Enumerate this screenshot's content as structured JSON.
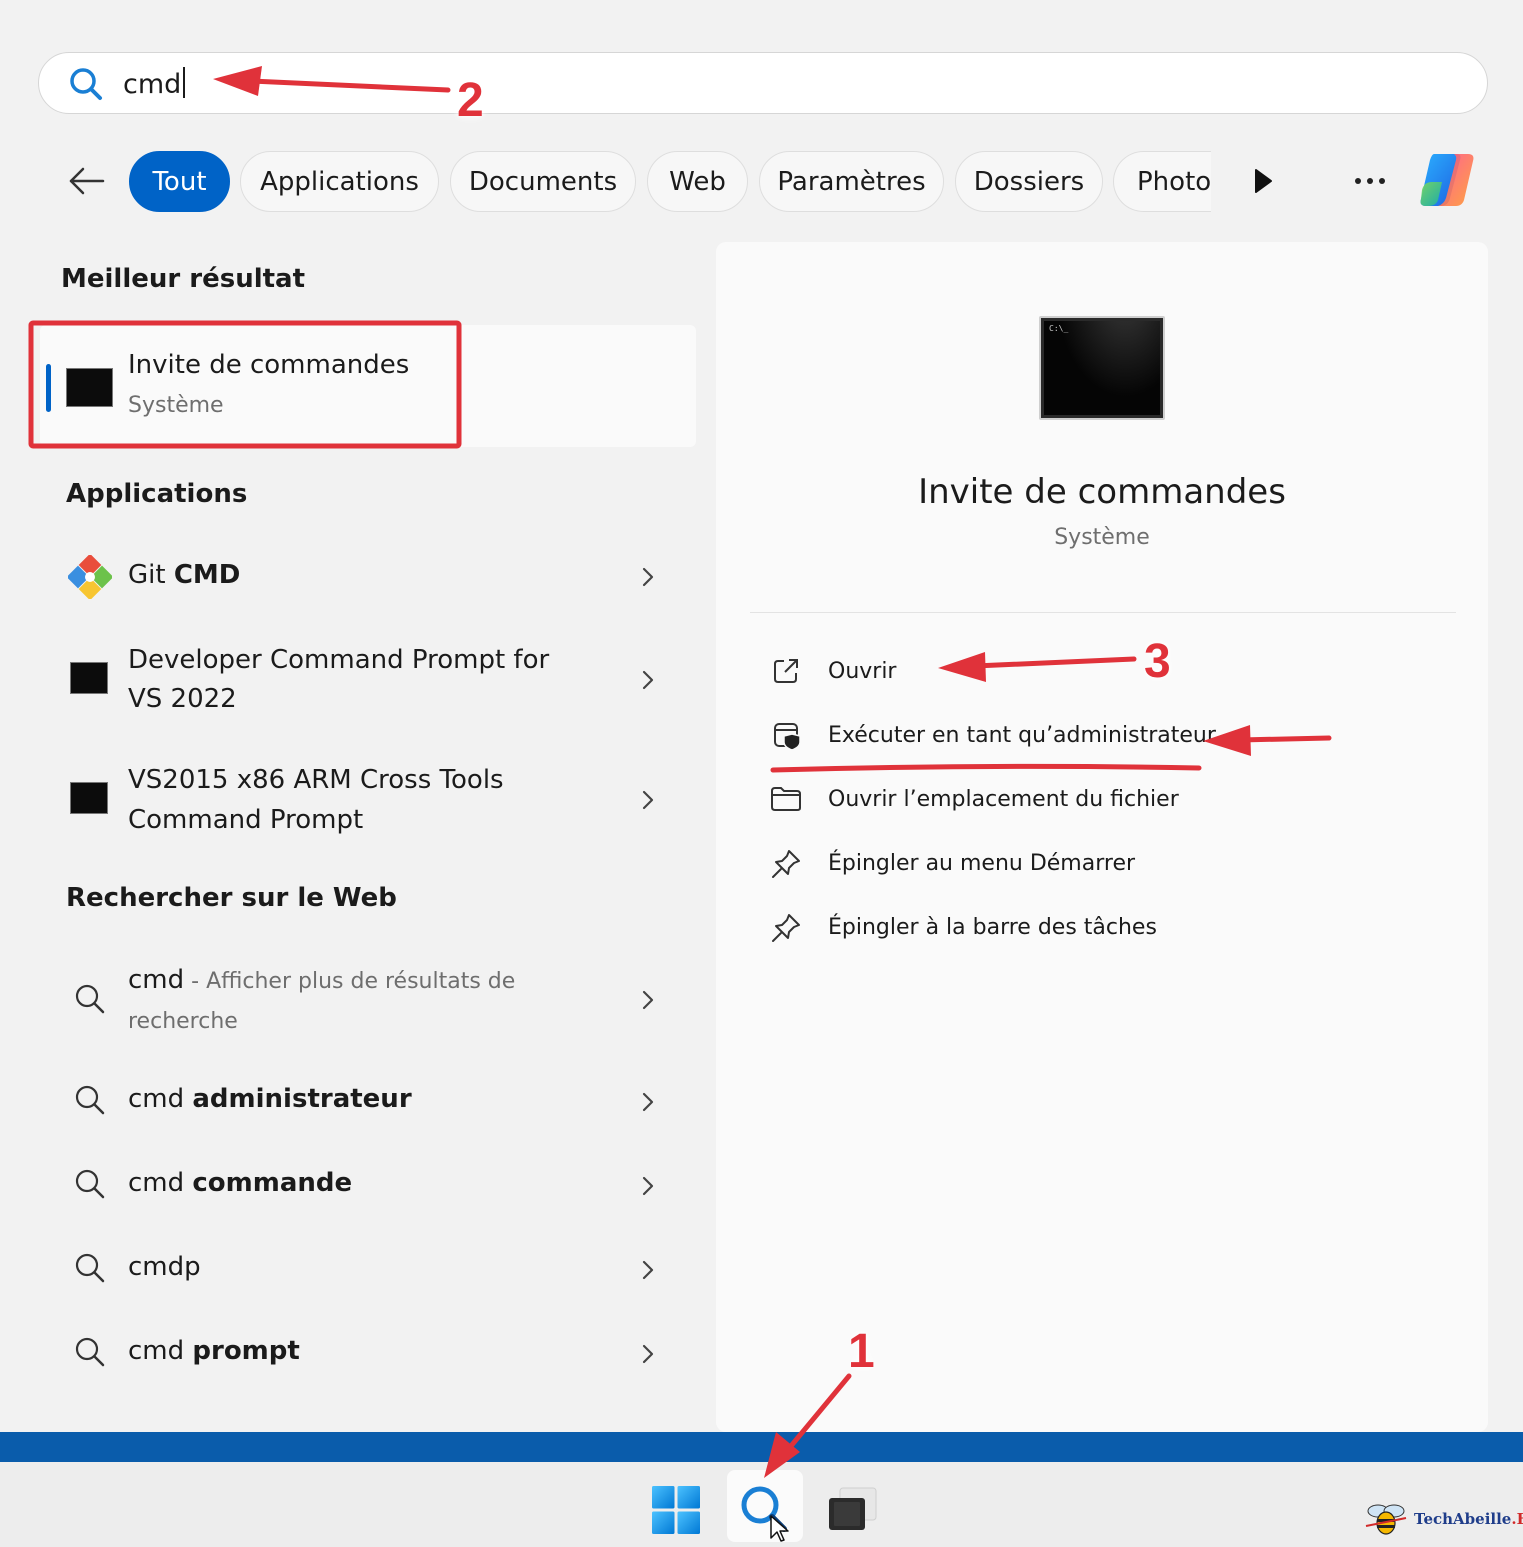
{
  "search": {
    "query": "cmd"
  },
  "filters": {
    "items": [
      "Tout",
      "Applications",
      "Documents",
      "Web",
      "Paramètres",
      "Dossiers",
      "Photo"
    ],
    "active": "Tout"
  },
  "best_match": {
    "section_title": "Meilleur résultat",
    "name": "Invite de commandes",
    "type": "Système"
  },
  "apps": {
    "section_title": "Applications",
    "items": [
      {
        "prefix": "Git ",
        "bold": "CMD"
      },
      {
        "line1": "Developer Command Prompt for",
        "line2": "VS 2022"
      },
      {
        "line1": "VS2015 x86 ARM Cross Tools",
        "line2": "Command Prompt"
      }
    ]
  },
  "web": {
    "section_title": "Rechercher sur le Web",
    "first": {
      "term": "cmd",
      "desc1": " - Afficher plus de résultats de",
      "desc2": "recherche"
    },
    "items": [
      {
        "normal": "cmd ",
        "bold": "administrateur"
      },
      {
        "normal": "cmd ",
        "bold": "commande"
      },
      {
        "normal": "cmdp",
        "bold": ""
      },
      {
        "normal": "cmd ",
        "bold": "prompt"
      }
    ]
  },
  "preview": {
    "name": "Invite de commandes",
    "type": "Système",
    "icon_caption": "C:\\_",
    "actions": [
      "Ouvrir",
      "Exécuter en tant qu’administrateur",
      "Ouvrir l’emplacement du fichier",
      "Épingler au menu Démarrer",
      "Épingler à la barre des tâches"
    ]
  },
  "annotations": {
    "step1": "1",
    "step2": "2",
    "step3": "3"
  },
  "watermark": {
    "brand": "TechAbeille",
    "suffix": ".FR"
  },
  "colors": {
    "accent": "#0063c7",
    "annotation": "#e0323a",
    "taskbar_band": "#0a5cab"
  }
}
